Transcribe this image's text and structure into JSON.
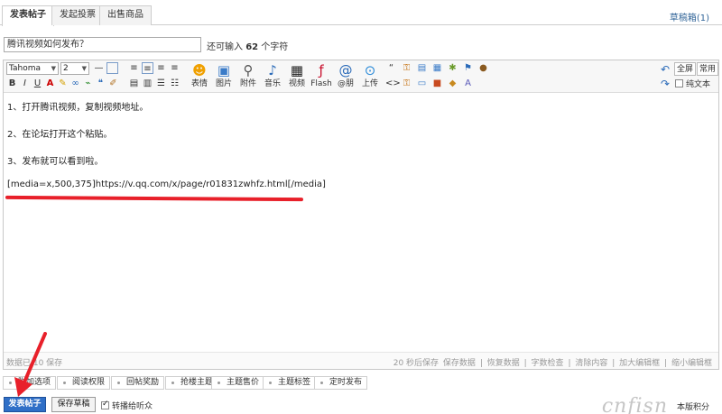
{
  "tabs": [
    "发表帖子",
    "发起投票",
    "出售商品"
  ],
  "draft_link": "草稿箱(1)",
  "title": {
    "value": "腾讯视频如何发布？",
    "count_prefix": "还可输入",
    "count_value": "62",
    "count_suffix": "个字符"
  },
  "toolbar": {
    "font_family": "Tahoma",
    "font_size": "2",
    "big_buttons": [
      {
        "label": "表情",
        "icon": "smiley-icon"
      },
      {
        "label": "图片",
        "icon": "image-icon"
      },
      {
        "label": "附件",
        "icon": "paperclip-icon"
      },
      {
        "label": "音乐",
        "icon": "music-note-icon"
      },
      {
        "label": "视频",
        "icon": "video-icon"
      },
      {
        "label": "Flash",
        "icon": "flash-icon"
      },
      {
        "label": "@朋",
        "icon": "at-icon"
      },
      {
        "label": "上传",
        "icon": "upload-icon"
      }
    ],
    "fullscreen": "全屏",
    "common": "常用",
    "plain_text": "纯文本"
  },
  "content": {
    "lines": [
      "1、打开腾讯视频，复制视频地址。",
      "2、在论坛打开这个粘贴。",
      "3、发布就可以看到啦。",
      "[media=x,500,375]https://v.qq.com/x/page/r01831zwhfz.html[/media]"
    ],
    "underline_color": "#e8202a"
  },
  "statusbar": {
    "left": "数据已      10 保存",
    "right": [
      "20 秒后保存",
      "保存数据",
      "|",
      "恢复数据",
      "|",
      "字数检查",
      "|",
      "清除内容",
      "|",
      "加大编辑框",
      "|",
      "缩小编辑框"
    ]
  },
  "options": [
    "附加选项",
    "阅读权限",
    "回帖奖励",
    "抢楼主题",
    "主题售价",
    "主题标签",
    "定时发布"
  ],
  "bottom": {
    "submit": "发表帖子",
    "save_draft": "保存草稿",
    "broadcast": "转播给听众",
    "rules": "本版积分",
    "watermark": "cnfisn"
  },
  "colors": {
    "accent": "#2f6fc7",
    "arrow": "#e8202a"
  }
}
